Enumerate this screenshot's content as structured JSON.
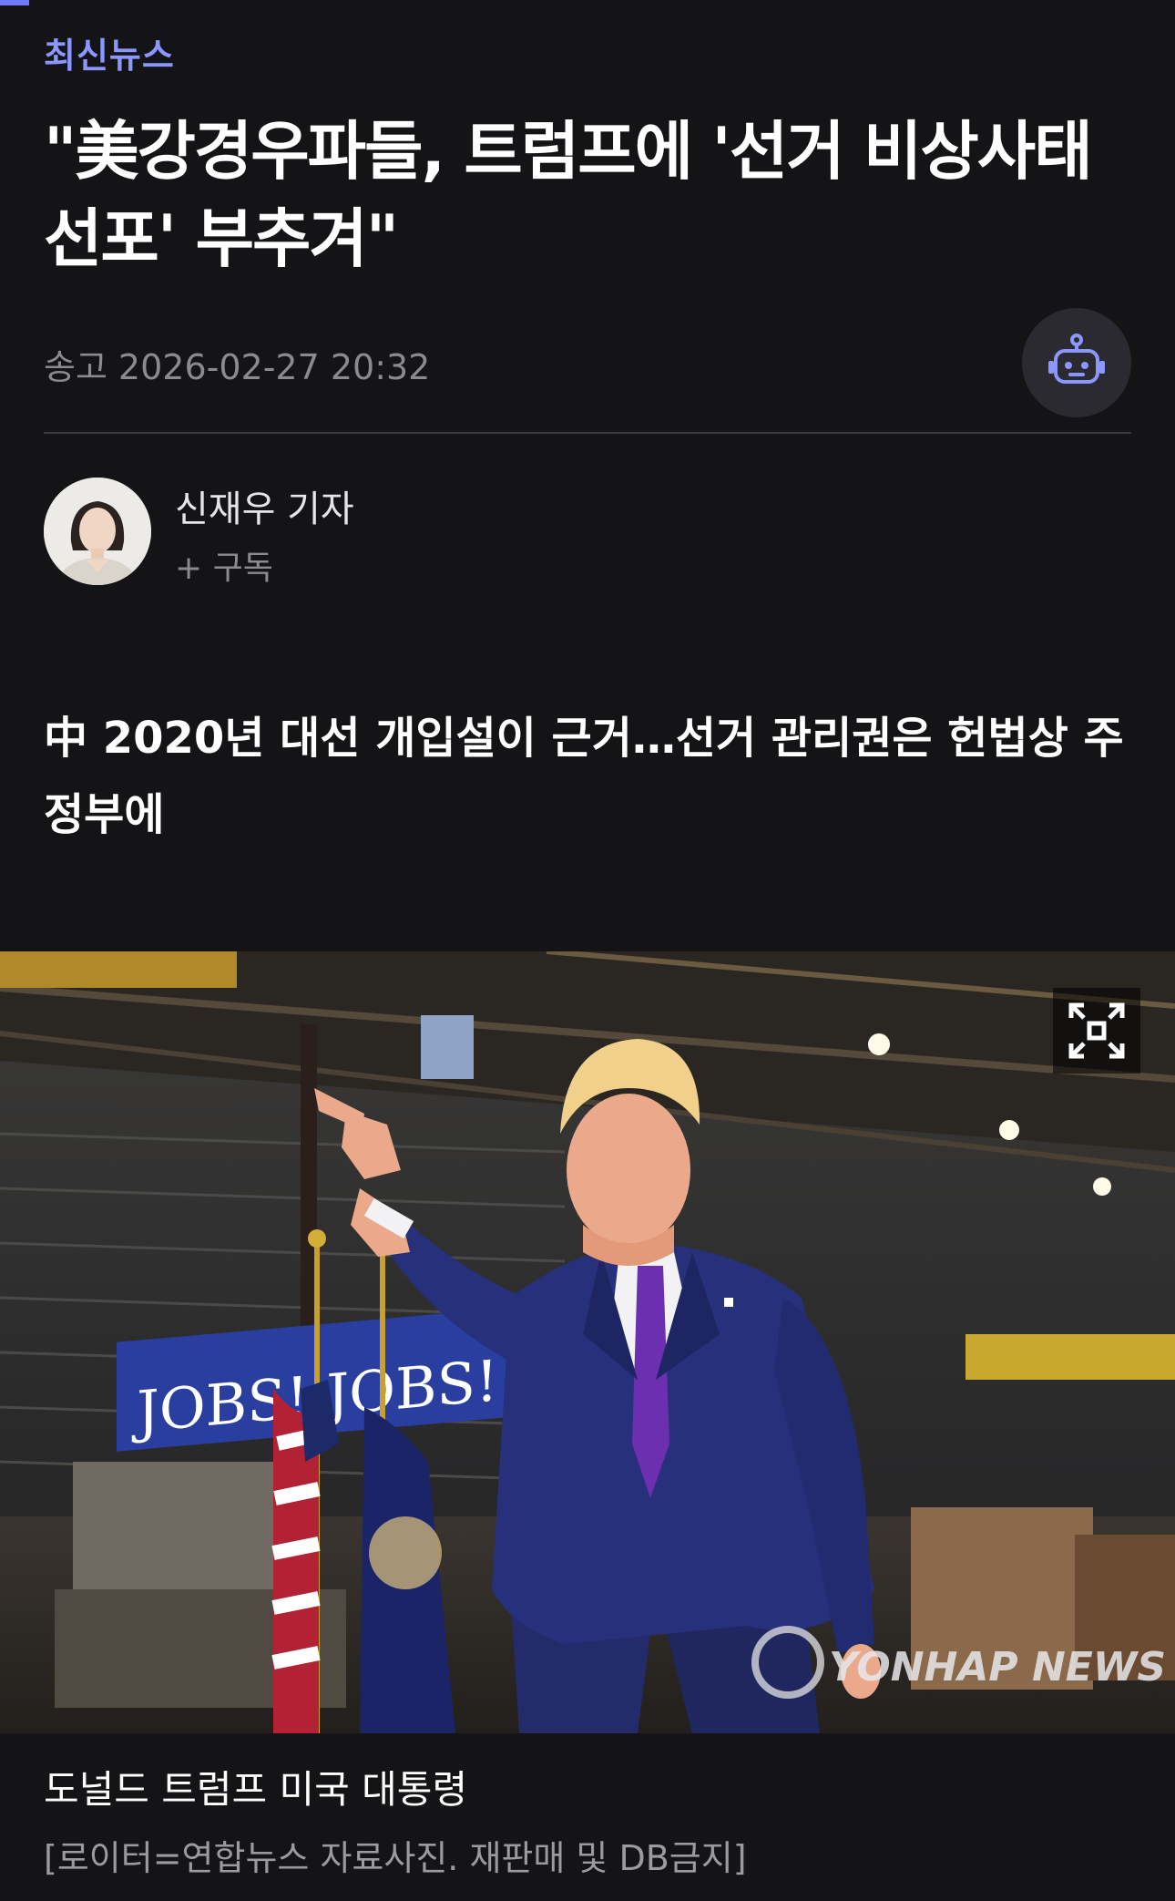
{
  "reading_progress": 0.025,
  "section": {
    "label": "최신뉴스"
  },
  "article": {
    "headline": "\"美강경우파들, 트럼프에 '선거 비상사태 선포' 부추겨\"",
    "date_label": "송고",
    "date": "2026-02-27 20:32",
    "subheadline": "中 2020년 대선 개입설이 근거…선거 관리권은 헌법상 주정부에"
  },
  "author": {
    "name": "신재우 기자",
    "subscribe": "+ 구독"
  },
  "photo": {
    "banner_text": "JOBS! JOBS! JOBS!",
    "watermark": "YONHAP NEWS",
    "caption": "도널드 트럼프 미국 대통령",
    "credit": "[로이터=연합뉴스 자료사진. 재판매 및 DB금지]"
  },
  "colors": {
    "accent": "#8c96ff",
    "background": "#141417",
    "suit": "#27307a",
    "tie": "#6b2fb0"
  },
  "icons": {
    "ai_button": "robot-icon",
    "expand": "expand-icon"
  }
}
